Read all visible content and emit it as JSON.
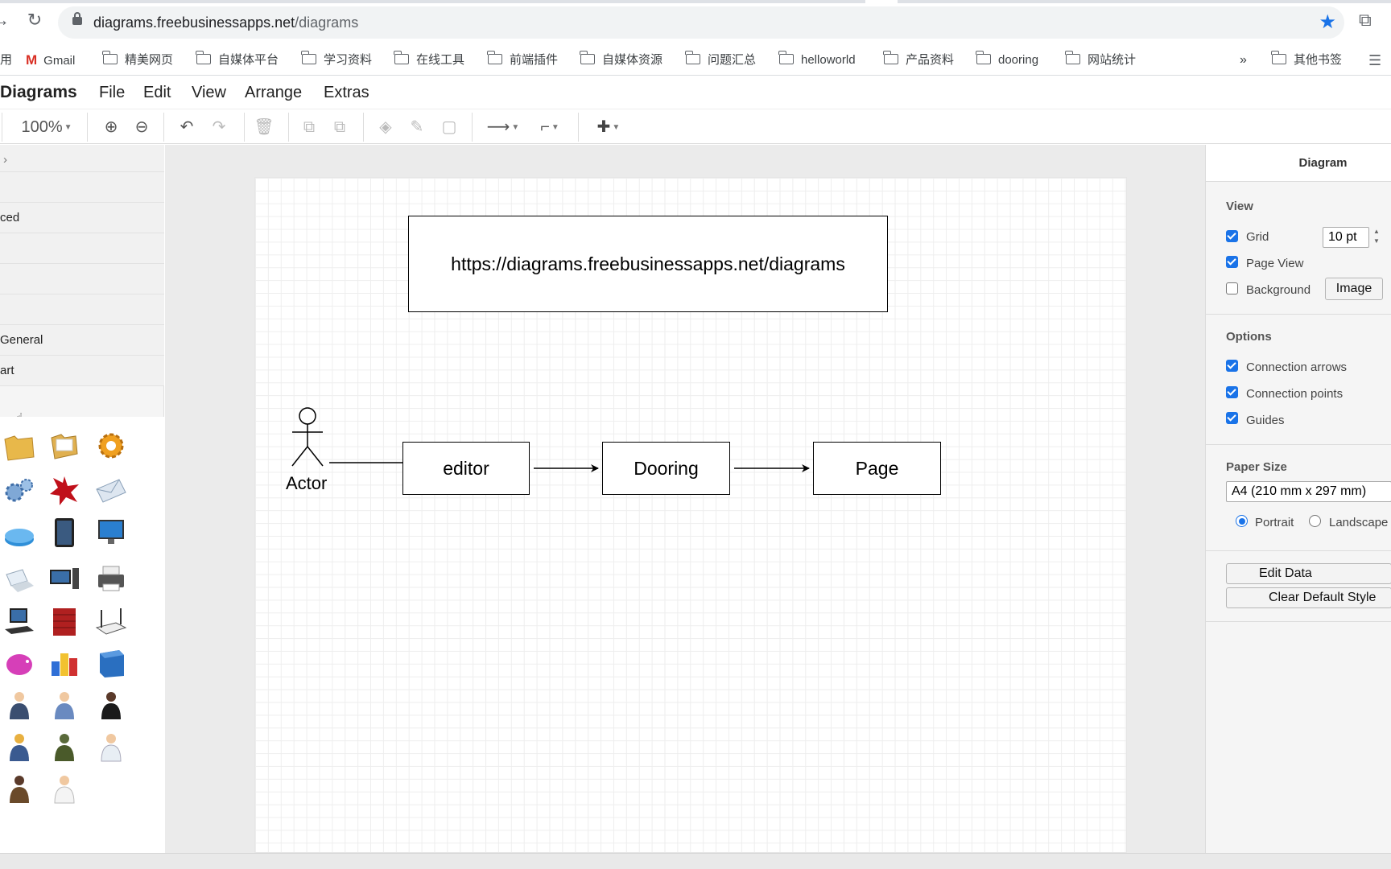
{
  "browser": {
    "url_host": "diagrams.freebusinessapps.net",
    "url_path": "/diagrams"
  },
  "bookmarks": {
    "left_partial": "用",
    "items": [
      {
        "label": "Gmail",
        "icon": "gmail-icon"
      },
      {
        "label": "精美网页",
        "icon": "folder-icon"
      },
      {
        "label": "自媒体平台",
        "icon": "folder-icon"
      },
      {
        "label": "学习资料",
        "icon": "folder-icon"
      },
      {
        "label": "在线工具",
        "icon": "folder-icon"
      },
      {
        "label": "前端插件",
        "icon": "folder-icon"
      },
      {
        "label": "自媒体资源",
        "icon": "folder-icon"
      },
      {
        "label": "问题汇总",
        "icon": "folder-icon"
      },
      {
        "label": "helloworld",
        "icon": "folder-icon"
      },
      {
        "label": "产品资料",
        "icon": "folder-icon"
      },
      {
        "label": "dooring",
        "icon": "folder-icon"
      },
      {
        "label": "网站统计",
        "icon": "folder-icon"
      }
    ],
    "overflow": "»",
    "other": "其他书签"
  },
  "app": {
    "title": "Diagrams",
    "menu": [
      "File",
      "Edit",
      "View",
      "Arrange",
      "Extras"
    ]
  },
  "toolbar": {
    "zoom": "100%"
  },
  "sidebar": {
    "rows": [
      "ced",
      "General",
      "art"
    ]
  },
  "diagram": {
    "url_box": "https://diagrams.freebusinessapps.net/diagrams",
    "actor_label": "Actor",
    "nodes": [
      "editor",
      "Dooring",
      "Page"
    ]
  },
  "right_panel": {
    "title": "Diagram",
    "view": {
      "heading": "View",
      "grid_label": "Grid",
      "grid_value": "10 pt",
      "page_view_label": "Page View",
      "background_label": "Background",
      "image_button": "Image"
    },
    "options": {
      "heading": "Options",
      "items": [
        "Connection arrows",
        "Connection points",
        "Guides"
      ]
    },
    "paper": {
      "heading": "Paper Size",
      "size": "A4 (210 mm x 297 mm)",
      "portrait": "Portrait",
      "landscape": "Landscape"
    },
    "buttons": {
      "edit_data": "Edit Data",
      "clear_default_style": "Clear Default Style"
    }
  },
  "colors": {
    "accent": "#1a73e8",
    "gmail": "#d93025"
  }
}
